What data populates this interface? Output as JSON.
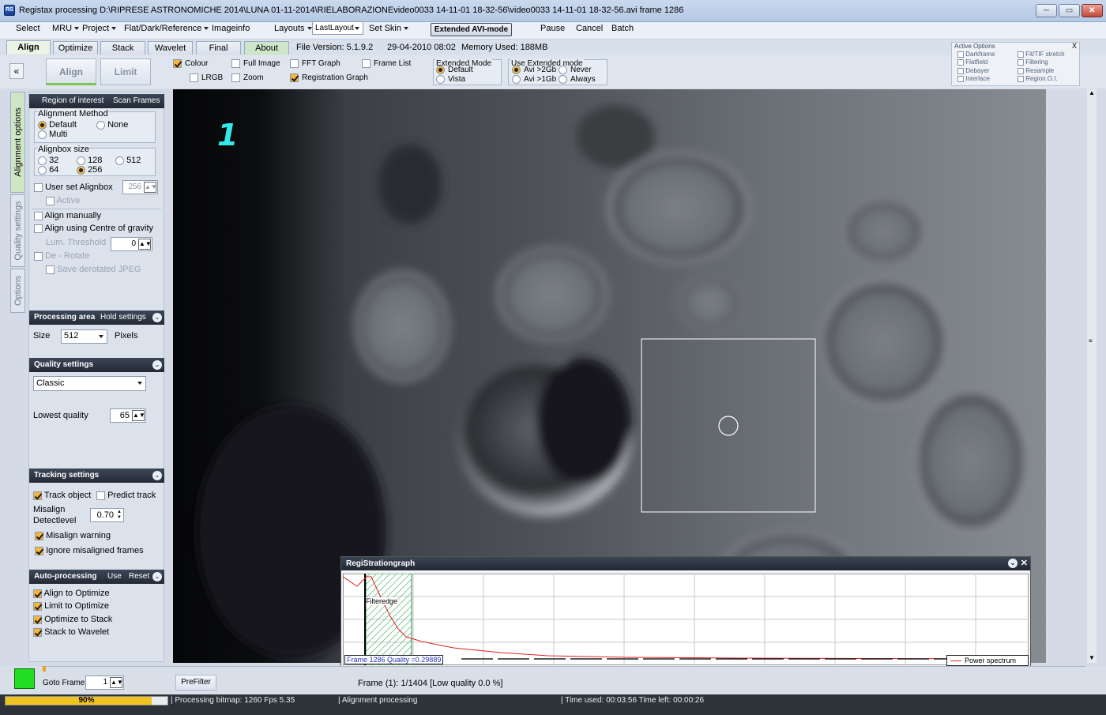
{
  "window": {
    "title": "Registax processing D:\\RIPRESE ASTRONOMICHE 2014\\LUNA 01-11-2014\\RIELABORAZIONEvideo0033 14-11-01 18-32-56\\video0033 14-11-01 18-32-56.avi frame 1286",
    "app_icon_text": "Regi\nStax",
    "min": "─",
    "max": "▭",
    "close": "✕"
  },
  "menubar": {
    "select": "Select",
    "mru": "MRU",
    "project": "Project",
    "flat": "Flat/Dark/Reference",
    "imageinfo": "Imageinfo",
    "layouts": "Layouts",
    "layout_value": "LastLayout",
    "setskin": "Set Skin",
    "extended_avi": "Extended AVI-mode",
    "pause": "Pause",
    "cancel": "Cancel",
    "batch": "Batch"
  },
  "tabs": [
    "Align",
    "Optimize",
    "Stack",
    "Wavelet",
    "Final",
    "About"
  ],
  "fileinfo": {
    "version": "File Version: 5.1.9.2",
    "date": "29-04-2010 08:02",
    "memory": "Memory Used: 188MB"
  },
  "toolbar": {
    "collapse": "«",
    "align_btn": "Align",
    "limit_btn": "Limit",
    "colour": "Colour",
    "lrgb": "LRGB",
    "full_image": "Full Image",
    "zoom": "Zoom",
    "fft_graph": "FFT Graph",
    "registration_graph": "Registration Graph",
    "frame_list": "Frame List",
    "extended_mode_title": "Extended Mode",
    "ext_default": "Default",
    "ext_vista": "Vista",
    "use_ext_title": "Use  Extended mode",
    "avi_2gb": "Avi >2Gb",
    "avi_1gb": "Avi >1Gb",
    "never": "Never",
    "always": "Always"
  },
  "active_options": {
    "title": "Active Options",
    "close": "X",
    "items_left": [
      "Darkframe",
      "Flatfield",
      "Debayer",
      "Interlace"
    ],
    "items_right": [
      "Fit/TIF stretch",
      "Filtering",
      "Resample",
      "Region.O.I."
    ]
  },
  "vtabs": [
    "Alignment options",
    "Quality settings",
    "Options"
  ],
  "left": {
    "roi_head": "Region of interest",
    "scan_frames": "Scan Frames",
    "align_method": "Alignment Method",
    "default": "Default",
    "none": "None",
    "multi": "Multi",
    "alignbox_size": "Alignbox size",
    "s32": "32",
    "s128": "128",
    "s512": "512",
    "s64": "64",
    "s256": "256",
    "user_set": "User set Alignbox",
    "user_set_val": "256",
    "active": "Active",
    "align_manually": "Align manually",
    "align_cog": "Align using Centre of gravity",
    "lum_threshold": "Lum. Threshold",
    "lum_val": "0",
    "derotate": "De - Rotate",
    "save_derot": "Save derotated JPEG",
    "proc_area": "Processing area",
    "hold_settings": "Hold settings",
    "size": "Size",
    "size_val": "512",
    "pixels": "Pixels",
    "quality_head": "Quality settings",
    "quality_val": "Classic",
    "lowest_quality": "Lowest quality",
    "lowest_val": "65",
    "tracking_head": "Tracking settings",
    "track_object": "Track object",
    "predict_track": "Predict track",
    "misalign_det": "Misalign\nDetectlevel",
    "misalign_l1": "Misalign",
    "misalign_l2": "Detectlevel",
    "misalign_val": "0.70",
    "misalign_warning": "Misalign warning",
    "ignore_misaligned": "Ignore misaligned frames",
    "auto_head": "Auto-processing",
    "use": "Use",
    "reset": "Reset",
    "a2o": "Align to Optimize",
    "l2o": "Limit to Optimize",
    "o2s": "Optimize to Stack",
    "s2w": "Stack to Wavelet"
  },
  "image": {
    "label": "1"
  },
  "graph": {
    "title": "RegiStrationgraph",
    "filteredge": "Filteredge",
    "frame_quality": "Frame 1286 Quality =0.29889",
    "legend": "Power spectrum"
  },
  "bottom": {
    "goto_frame": "Goto Frame",
    "goto_val": "1",
    "prefilter": "PreFilter",
    "frame_status": "Frame (1): 1/1404 [Low quality 0.0 %]",
    "progress_label": "90%",
    "progress": 0.9,
    "status1": "Processing bitmap: 1260 Fps 5.35",
    "status2": "Alignment processing",
    "status3": "Time used: 00:03:56 Time left: 00:00:26"
  },
  "colors": {
    "status_square": "#22dd22",
    "label_cyan": "#35e8e8",
    "progress_fill": "#f0c420",
    "graph_line": "#e02020"
  }
}
